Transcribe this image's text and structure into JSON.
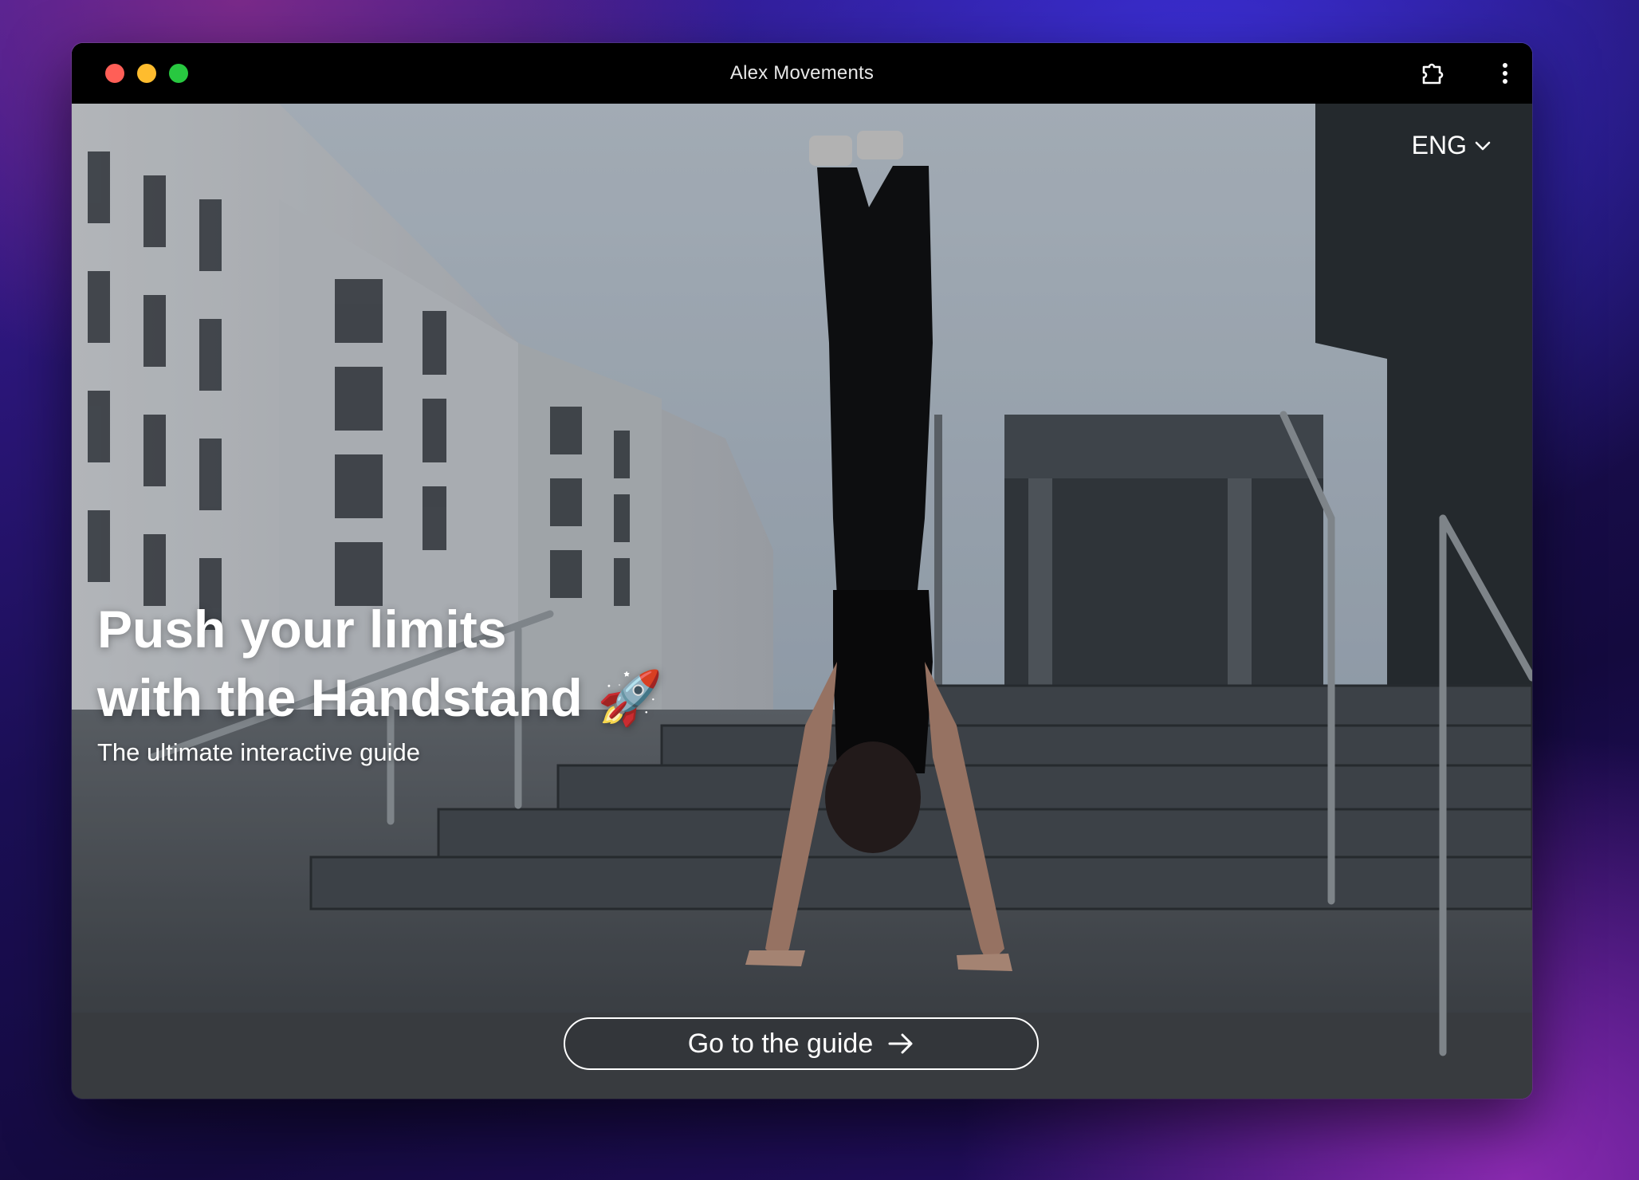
{
  "window": {
    "title": "Alex Movements"
  },
  "toolbar": {
    "extension_icon": "puzzle-piece-icon",
    "menu_icon": "kebab-menu-icon"
  },
  "hero": {
    "language": "ENG",
    "headline_line1": "Push your limits",
    "headline_line2": "with the Handstand",
    "headline_emoji": "🚀",
    "subtitle": "The ultimate interactive guide",
    "cta_label": "Go to the guide",
    "image_description_icon": "handstand-photo"
  },
  "colors": {
    "traffic_red": "#ff5f57",
    "traffic_yellow": "#febc2e",
    "traffic_green": "#28c840",
    "titlebar": "#000000"
  }
}
